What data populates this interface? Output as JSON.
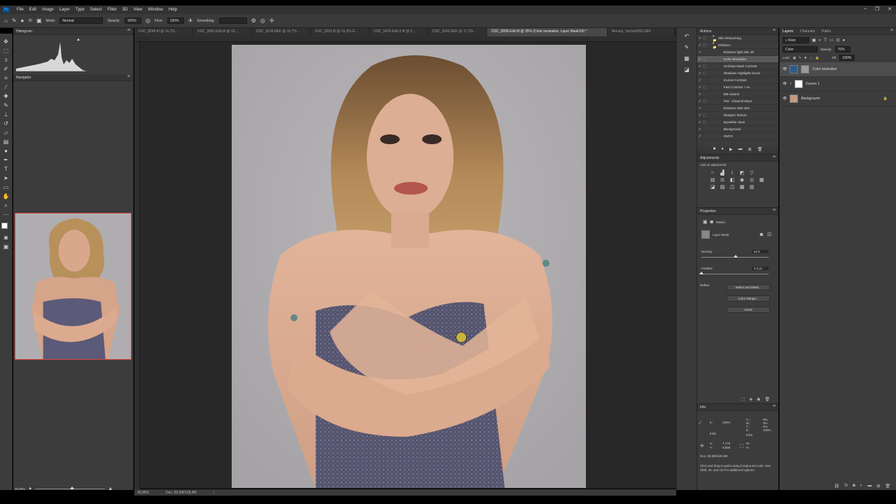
{
  "app": {
    "logo": "Ps"
  },
  "menu": [
    "File",
    "Edit",
    "Image",
    "Layer",
    "Type",
    "Select",
    "Filter",
    "3D",
    "View",
    "Window",
    "Help"
  ],
  "options": {
    "mode_label": "Mode:",
    "mode_value": "Normal",
    "opacity_label": "Opacity:",
    "opacity_value": "100%",
    "flow_label": "Flow:",
    "flow_value": "100%",
    "smoothing_label": "Smoothing:",
    "smoothing_value": "",
    "brush_size": "30"
  },
  "left_panels": {
    "histogram_title": "Histogram",
    "navigator_title": "Navigator",
    "zoom": "35,85%"
  },
  "tabs": [
    {
      "label": "DSC_8548.tif @ 16,1% ..."
    },
    {
      "label": "DSC_3081-Edit.tif @ 16,..."
    },
    {
      "label": "DSC_9109.NEF @ 16,7% ..."
    },
    {
      "label": "DSC_2822.tif @ 16,3% G..."
    },
    {
      "label": "DSC_5425-Edit-2.tif @ 2..."
    },
    {
      "label": "DSC_3093.NEF @ 17,1%..."
    },
    {
      "label": "DSC_8938-Edit.tif @ 35% (Color neutralize, Layer Mask/16) *",
      "active": true
    },
    {
      "label": "Monica_Vachel0052.NEF"
    }
  ],
  "status": {
    "zoom": "35,85%",
    "doc": "Doc: 59,3M/128,4M"
  },
  "actions": {
    "title": "Actions",
    "items": [
      {
        "label": "Skin Retouching",
        "check": "✓",
        "box": "▢",
        "sel": false
      },
      {
        "label": "Enhance",
        "check": "✓",
        "box": "▢",
        "sel": false
      },
      {
        "label": "Enhance light skin JR",
        "check": "✓",
        "box": "",
        "sel": false
      },
      {
        "label": "Color Neutralize",
        "check": "✓",
        "box": "▢",
        "sel": true
      },
      {
        "label": "Uncharp Mask Contrast",
        "check": "✓",
        "box": "▢",
        "sel": false
      },
      {
        "label": "Shadows Highlights boost",
        "check": "✓",
        "box": "▢",
        "sel": false
      },
      {
        "label": "Curves Contrast",
        "check": "✓",
        "box": "",
        "sel": false
      },
      {
        "label": "Fast Contrast + HL",
        "check": "✓",
        "box": "▢",
        "sel": false
      },
      {
        "label": "DB-volume",
        "check": "✓",
        "box": "",
        "sel": false
      },
      {
        "label": "Tint - Channel Mixer",
        "check": "✓",
        "box": "▢",
        "sel": false
      },
      {
        "label": "Enhance dark skin",
        "check": "✓",
        "box": "",
        "sel": false
      },
      {
        "label": "Sharpen Texture",
        "check": "✓",
        "box": "▢",
        "sel": false
      },
      {
        "label": "Eyewhite clean",
        "check": "✓",
        "box": "▢",
        "sel": false
      },
      {
        "label": "Background",
        "check": "✓",
        "box": "",
        "sel": false
      },
      {
        "label": "CMYK",
        "check": "✓",
        "box": "",
        "sel": false
      }
    ]
  },
  "adjustments": {
    "title": "Adjustments",
    "hint": "Add an adjustment"
  },
  "properties": {
    "title": "Properties",
    "masks_label": "Masks",
    "layer_mask_label": "Layer Mask",
    "density_label": "Density:",
    "density_value": "51%",
    "density_level": 0.51,
    "feather_label": "Feather:",
    "feather_value": "0,0 px",
    "feather_level": 0.0,
    "refine_label": "Refine:",
    "select_mask_button": "Select and Mask...",
    "color_range_button": "Color Range...",
    "invert_button": "Invert"
  },
  "info": {
    "title": "Info",
    "k_label": "K :",
    "k_value": "100%",
    "bit_left": "8-bit",
    "bit_right": "8-bit",
    "x_label": "X :",
    "x_value": "7,770",
    "y_label": "Y :",
    "y_value": "6,890",
    "w_label": "W :",
    "h_label": "H :",
    "cmyk_labels": "C :\nM :\nY :\nK :",
    "cmyk_values": "0%\n0%\n0%\n100%",
    "doc": "Doc: 59,3M/128,4M",
    "hint": "Click and drag to paint using foreground color. Use Shift, Alt, and Ctrl for additional options."
  },
  "layers": {
    "tabs": [
      "Layers",
      "Channels",
      "Paths"
    ],
    "kind_label": "Kind",
    "blend_mode": "Color",
    "opacity_label": "Opacity:",
    "opacity_value": "70%",
    "lock_label": "Lock:",
    "fill_label": "Fill:",
    "fill_value": "100%",
    "items": [
      {
        "name": "Color neutralize",
        "sel": true
      },
      {
        "name": "Curves 1",
        "sel": false
      },
      {
        "name": "Background",
        "sel": false
      }
    ]
  },
  "colors": {
    "accent": "#31a8ff",
    "panel": "#3c3c3c",
    "canvas_bg": "#282828",
    "nav_frame": "#d8433a",
    "photo_bg": "#adaaad"
  }
}
